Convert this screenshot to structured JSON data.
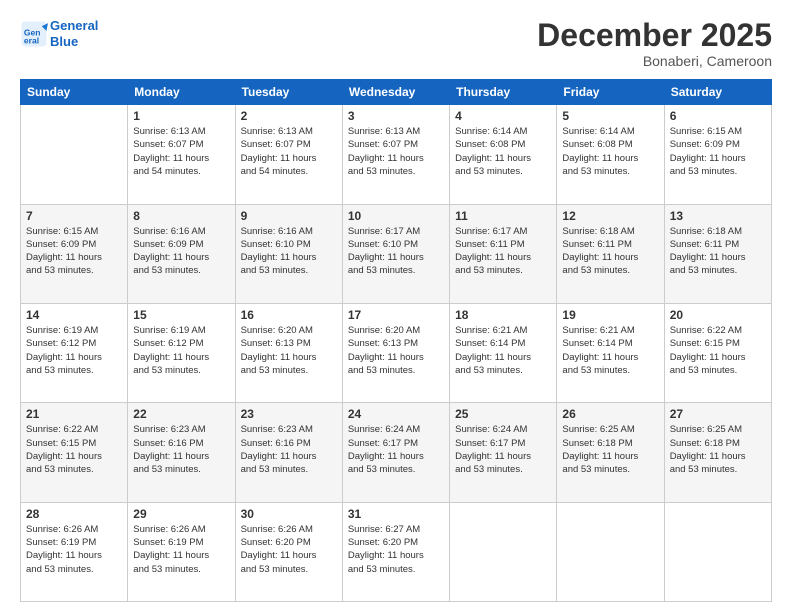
{
  "header": {
    "logo_line1": "General",
    "logo_line2": "Blue",
    "month_title": "December 2025",
    "location": "Bonaberi, Cameroon"
  },
  "weekdays": [
    "Sunday",
    "Monday",
    "Tuesday",
    "Wednesday",
    "Thursday",
    "Friday",
    "Saturday"
  ],
  "rows": [
    [
      {
        "day": "",
        "info": ""
      },
      {
        "day": "1",
        "info": "Sunrise: 6:13 AM\nSunset: 6:07 PM\nDaylight: 11 hours\nand 54 minutes."
      },
      {
        "day": "2",
        "info": "Sunrise: 6:13 AM\nSunset: 6:07 PM\nDaylight: 11 hours\nand 54 minutes."
      },
      {
        "day": "3",
        "info": "Sunrise: 6:13 AM\nSunset: 6:07 PM\nDaylight: 11 hours\nand 53 minutes."
      },
      {
        "day": "4",
        "info": "Sunrise: 6:14 AM\nSunset: 6:08 PM\nDaylight: 11 hours\nand 53 minutes."
      },
      {
        "day": "5",
        "info": "Sunrise: 6:14 AM\nSunset: 6:08 PM\nDaylight: 11 hours\nand 53 minutes."
      },
      {
        "day": "6",
        "info": "Sunrise: 6:15 AM\nSunset: 6:09 PM\nDaylight: 11 hours\nand 53 minutes."
      }
    ],
    [
      {
        "day": "7",
        "info": "Sunrise: 6:15 AM\nSunset: 6:09 PM\nDaylight: 11 hours\nand 53 minutes."
      },
      {
        "day": "8",
        "info": "Sunrise: 6:16 AM\nSunset: 6:09 PM\nDaylight: 11 hours\nand 53 minutes."
      },
      {
        "day": "9",
        "info": "Sunrise: 6:16 AM\nSunset: 6:10 PM\nDaylight: 11 hours\nand 53 minutes."
      },
      {
        "day": "10",
        "info": "Sunrise: 6:17 AM\nSunset: 6:10 PM\nDaylight: 11 hours\nand 53 minutes."
      },
      {
        "day": "11",
        "info": "Sunrise: 6:17 AM\nSunset: 6:11 PM\nDaylight: 11 hours\nand 53 minutes."
      },
      {
        "day": "12",
        "info": "Sunrise: 6:18 AM\nSunset: 6:11 PM\nDaylight: 11 hours\nand 53 minutes."
      },
      {
        "day": "13",
        "info": "Sunrise: 6:18 AM\nSunset: 6:11 PM\nDaylight: 11 hours\nand 53 minutes."
      }
    ],
    [
      {
        "day": "14",
        "info": "Sunrise: 6:19 AM\nSunset: 6:12 PM\nDaylight: 11 hours\nand 53 minutes."
      },
      {
        "day": "15",
        "info": "Sunrise: 6:19 AM\nSunset: 6:12 PM\nDaylight: 11 hours\nand 53 minutes."
      },
      {
        "day": "16",
        "info": "Sunrise: 6:20 AM\nSunset: 6:13 PM\nDaylight: 11 hours\nand 53 minutes."
      },
      {
        "day": "17",
        "info": "Sunrise: 6:20 AM\nSunset: 6:13 PM\nDaylight: 11 hours\nand 53 minutes."
      },
      {
        "day": "18",
        "info": "Sunrise: 6:21 AM\nSunset: 6:14 PM\nDaylight: 11 hours\nand 53 minutes."
      },
      {
        "day": "19",
        "info": "Sunrise: 6:21 AM\nSunset: 6:14 PM\nDaylight: 11 hours\nand 53 minutes."
      },
      {
        "day": "20",
        "info": "Sunrise: 6:22 AM\nSunset: 6:15 PM\nDaylight: 11 hours\nand 53 minutes."
      }
    ],
    [
      {
        "day": "21",
        "info": "Sunrise: 6:22 AM\nSunset: 6:15 PM\nDaylight: 11 hours\nand 53 minutes."
      },
      {
        "day": "22",
        "info": "Sunrise: 6:23 AM\nSunset: 6:16 PM\nDaylight: 11 hours\nand 53 minutes."
      },
      {
        "day": "23",
        "info": "Sunrise: 6:23 AM\nSunset: 6:16 PM\nDaylight: 11 hours\nand 53 minutes."
      },
      {
        "day": "24",
        "info": "Sunrise: 6:24 AM\nSunset: 6:17 PM\nDaylight: 11 hours\nand 53 minutes."
      },
      {
        "day": "25",
        "info": "Sunrise: 6:24 AM\nSunset: 6:17 PM\nDaylight: 11 hours\nand 53 minutes."
      },
      {
        "day": "26",
        "info": "Sunrise: 6:25 AM\nSunset: 6:18 PM\nDaylight: 11 hours\nand 53 minutes."
      },
      {
        "day": "27",
        "info": "Sunrise: 6:25 AM\nSunset: 6:18 PM\nDaylight: 11 hours\nand 53 minutes."
      }
    ],
    [
      {
        "day": "28",
        "info": "Sunrise: 6:26 AM\nSunset: 6:19 PM\nDaylight: 11 hours\nand 53 minutes."
      },
      {
        "day": "29",
        "info": "Sunrise: 6:26 AM\nSunset: 6:19 PM\nDaylight: 11 hours\nand 53 minutes."
      },
      {
        "day": "30",
        "info": "Sunrise: 6:26 AM\nSunset: 6:20 PM\nDaylight: 11 hours\nand 53 minutes."
      },
      {
        "day": "31",
        "info": "Sunrise: 6:27 AM\nSunset: 6:20 PM\nDaylight: 11 hours\nand 53 minutes."
      },
      {
        "day": "",
        "info": ""
      },
      {
        "day": "",
        "info": ""
      },
      {
        "day": "",
        "info": ""
      }
    ]
  ]
}
